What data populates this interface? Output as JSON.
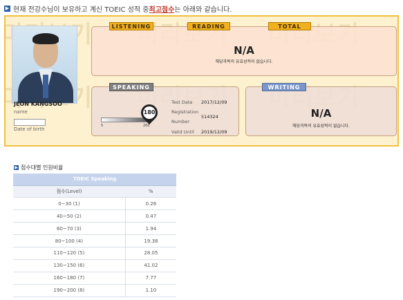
{
  "intro": {
    "prefix": "현재 전강수님이 보유하고 계신 TOEIC 성적 중 ",
    "highlight": "최고점수",
    "suffix": "는 아래와 같습니다."
  },
  "watermark": "미리보기",
  "profile": {
    "name": "JEON KANGSOO",
    "name_label": "name",
    "dob_label": "Date of birth"
  },
  "toeic": {
    "tabs": [
      "LISTENING",
      "READING",
      "TOTAL"
    ],
    "score": "N/A",
    "note": "해당과목의 유효성적이 없습니다."
  },
  "speaking": {
    "tab": "SPEAKING",
    "score": "180",
    "bar_min": "5",
    "bar_max": "200",
    "test_date_label": "Test Date",
    "test_date": "2017/12/09",
    "reg_label_1": "Registration",
    "reg_label_2": "Number",
    "reg_number": "514324",
    "valid_label": "Valid Until",
    "valid_until": "2019/12/09"
  },
  "writing": {
    "tab": "WRITING",
    "score": "N/A",
    "note": "해당과목의 유효성적이 없습니다."
  },
  "distribution": {
    "title": "점수대별 인원비율",
    "header": "TOEIC Speaking",
    "col_level": "점수(Level)",
    "col_pct": "%",
    "rows": [
      {
        "level": "0~30 (1)",
        "pct": "0.26"
      },
      {
        "level": "40~50 (2)",
        "pct": "0.47"
      },
      {
        "level": "60~70 (3)",
        "pct": "1.94"
      },
      {
        "level": "80~100 (4)",
        "pct": "19.38"
      },
      {
        "level": "110~120 (5)",
        "pct": "28.05"
      },
      {
        "level": "130~150 (6)",
        "pct": "41.02"
      },
      {
        "level": "160~180 (7)",
        "pct": "7.77"
      },
      {
        "level": "190~200 (8)",
        "pct": "1.10"
      }
    ]
  },
  "colors": {
    "accent": "#2a5fa8",
    "highlight": "#c0392b",
    "card_border": "#f0c040",
    "card_bg": "#fdf1cf",
    "tab_yellow": "#f0b020",
    "tab_gray": "#7f7f7f",
    "tab_blue": "#7b96c9"
  }
}
